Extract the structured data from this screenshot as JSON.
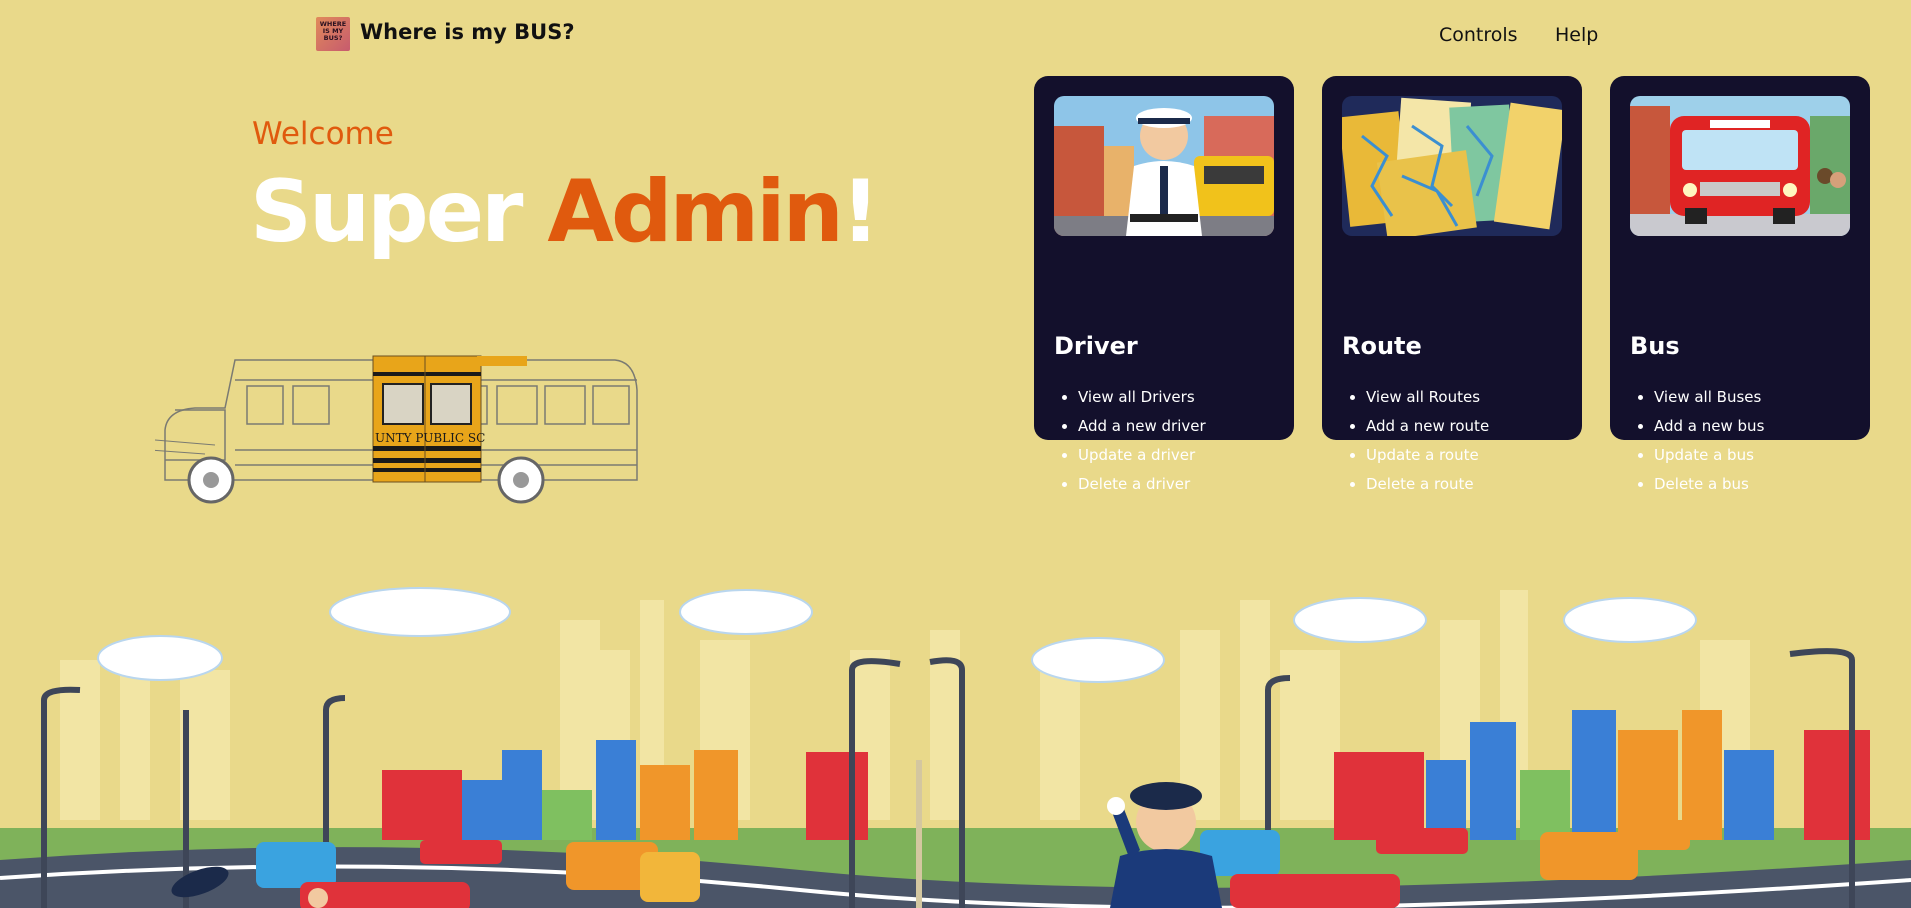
{
  "header": {
    "logo_text": "WHERE IS MY BUS?",
    "title": "Where is my BUS?",
    "nav": [
      "Controls",
      "Help"
    ]
  },
  "hero": {
    "welcome": "Welcome",
    "headline_part1": "Super",
    "headline_part2": "Admin",
    "headline_part3": "!",
    "bus_sign": "UNTY PUBLIC SC"
  },
  "cards": [
    {
      "title": "Driver",
      "items": [
        "View all Drivers",
        "Add a new driver",
        "Update a driver",
        "Delete a driver"
      ]
    },
    {
      "title": "Route",
      "items": [
        "View all Routes",
        "Add a new route",
        "Update a route",
        "Delete a route"
      ]
    },
    {
      "title": "Bus",
      "items": [
        "View all Buses",
        "Add a new bus",
        "Update a bus",
        "Delete a bus"
      ]
    }
  ],
  "colors": {
    "background": "#e9d98a",
    "accent": "#e05a0e",
    "card": "#13102c"
  }
}
